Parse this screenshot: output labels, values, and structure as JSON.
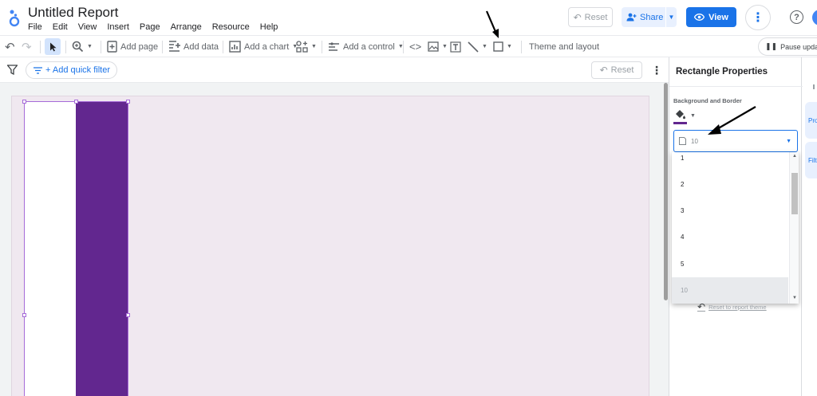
{
  "app": {
    "title": "Untitled Report",
    "menu": [
      "File",
      "Edit",
      "View",
      "Insert",
      "Page",
      "Arrange",
      "Resource",
      "Help"
    ]
  },
  "header": {
    "reset_label": "Reset",
    "share_label": "Share",
    "view_label": "View",
    "help_glyph": "?"
  },
  "toolbar": {
    "add_page": "Add page",
    "add_data": "Add data",
    "add_chart": "Add a chart",
    "add_control": "Add a control",
    "theme_layout": "Theme and layout",
    "pause_updates": "Pause update"
  },
  "filterbar": {
    "add_quick_filter": "+ Add quick filter",
    "reset_label": "Reset"
  },
  "properties": {
    "title": "Rectangle Properties",
    "section_label": "Background and Border",
    "fill_color": "#62278f",
    "border_weight_value": "10",
    "border_weight_options": [
      "1",
      "2",
      "3",
      "4",
      "5",
      "10"
    ],
    "reset_theme": "Reset to report theme"
  },
  "right_rail": {
    "tabs": [
      "Pro",
      "Filt"
    ]
  },
  "colors": {
    "accent": "#1a73e8",
    "rect_fill": "#62278f",
    "page_background": "#f0e8f0"
  },
  "icons": [
    "undo-icon",
    "redo-icon",
    "cursor-icon",
    "zoom-icon",
    "add-page-icon",
    "add-data-icon",
    "chart-icon",
    "control-icon",
    "code-icon",
    "image-icon",
    "text-icon",
    "line-icon",
    "rectangle-icon",
    "filter-icon",
    "fill-bucket-icon"
  ]
}
